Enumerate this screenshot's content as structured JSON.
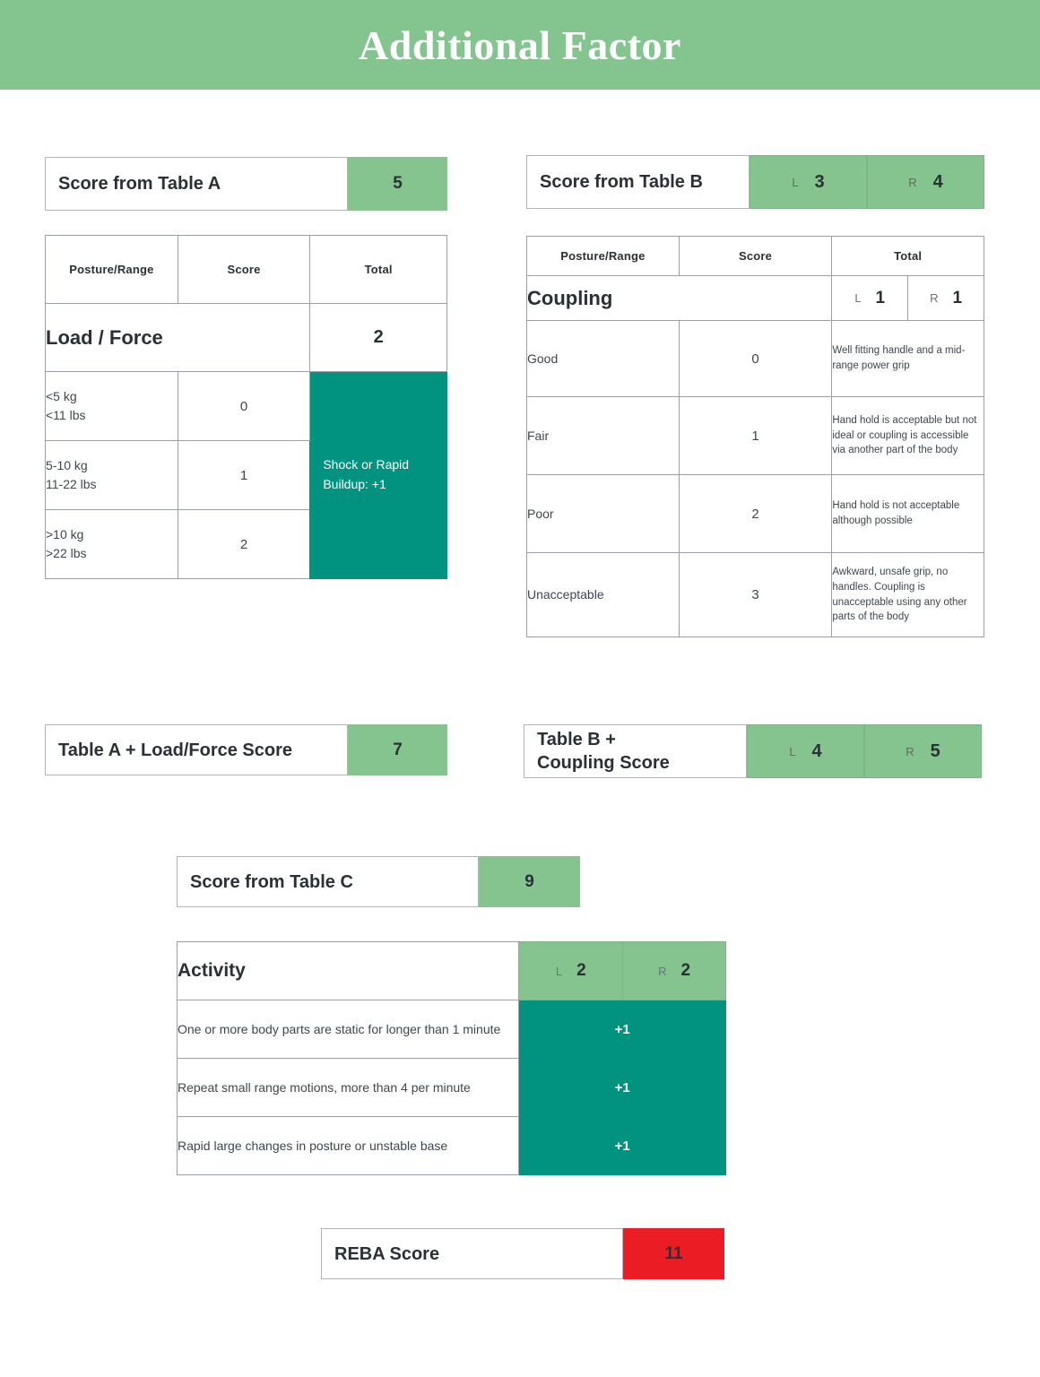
{
  "banner": {
    "title": "Additional Factor"
  },
  "colors": {
    "banner_green": "#83c48f",
    "accent_green": "#85c48e",
    "teal": "#029280",
    "red": "#ec1c24",
    "border": "#9aa0a6"
  },
  "score_table_a": {
    "label": "Score from Table A",
    "value": "5"
  },
  "score_table_b": {
    "label": "Score from Table B",
    "left_side": "L",
    "left_value": "3",
    "right_side": "R",
    "right_value": "4"
  },
  "load_force_table": {
    "headers": [
      "Posture/Range",
      "Score",
      "Total"
    ],
    "section_label": "Load / Force",
    "section_total": "2",
    "rows": [
      {
        "range": "<5 kg\n<11 lbs",
        "score": "0"
      },
      {
        "range": "5-10 kg\n11-22 lbs",
        "score": "1"
      },
      {
        "range": ">10 kg\n>22 lbs",
        "score": "2"
      }
    ],
    "note": "Shock or Rapid Buildup: +1"
  },
  "coupling_table": {
    "headers": [
      "Posture/Range",
      "Score",
      "Total"
    ],
    "section_label": "Coupling",
    "left_side": "L",
    "left_value": "1",
    "right_side": "R",
    "right_value": "1",
    "rows": [
      {
        "name": "Good",
        "score": "0",
        "description": "Well fitting handle and a mid-range power grip"
      },
      {
        "name": "Fair",
        "score": "1",
        "description": "Hand hold is acceptable but not ideal or coupling is accessible via another part of the body"
      },
      {
        "name": "Poor",
        "score": "2",
        "description": "Hand hold is not acceptable although possible"
      },
      {
        "name": "Unacceptable",
        "score": "3",
        "description": "Awkward, unsafe grip, no handles. Coupling is unacceptable using any other parts of the body"
      }
    ]
  },
  "table_a_plus_load": {
    "label": "Table A + Load/Force Score",
    "value": "7"
  },
  "table_b_plus_coupling": {
    "label": "Table B +\nCoupling Score",
    "left_side": "L",
    "left_value": "4",
    "right_side": "R",
    "right_value": "5"
  },
  "score_table_c": {
    "label": "Score from Table C",
    "value": "9"
  },
  "activity_table": {
    "title": "Activity",
    "left_side": "L",
    "left_value": "2",
    "right_side": "R",
    "right_value": "2",
    "rows": [
      {
        "description": "One or more body parts are static for longer than 1 minute",
        "value": "+1"
      },
      {
        "description": "Repeat small range motions, more than 4 per minute",
        "value": "+1"
      },
      {
        "description": "Rapid large changes in posture or unstable base",
        "value": "+1"
      }
    ]
  },
  "reba_score": {
    "label": "REBA Score",
    "value": "11"
  }
}
